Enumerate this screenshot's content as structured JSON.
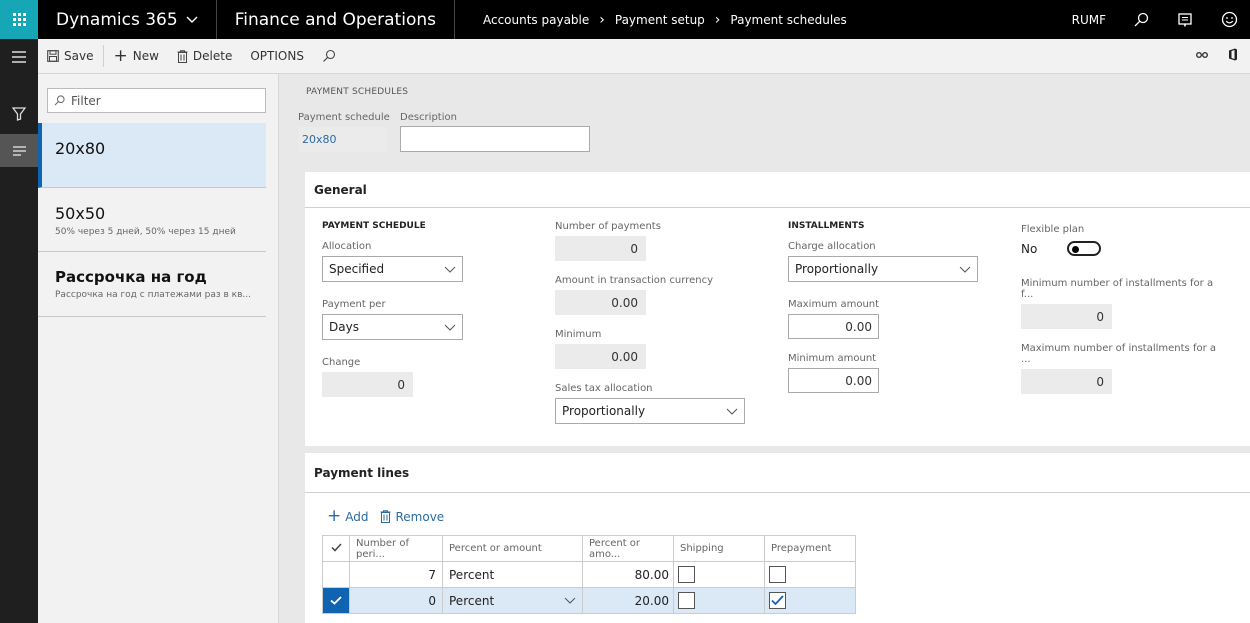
{
  "topbar": {
    "brand": "Dynamics 365",
    "app_name": "Finance and Operations",
    "breadcrumb": [
      "Accounts payable",
      "Payment setup",
      "Payment schedules"
    ],
    "company": "RUMF"
  },
  "actionbar": {
    "save": "Save",
    "new": "New",
    "delete": "Delete",
    "options": "OPTIONS"
  },
  "list": {
    "filter_placeholder": "Filter",
    "items": [
      {
        "title": "20x80",
        "subtitle": ""
      },
      {
        "title": "50x50",
        "subtitle": "50% через 5 дней, 50% через 15 дней"
      },
      {
        "title": "Рассрочка на год",
        "subtitle": "Рассрочка на год с платежами раз в кв..."
      }
    ]
  },
  "header": {
    "section": "PAYMENT SCHEDULES",
    "payment_schedule_label": "Payment schedule",
    "payment_schedule_value": "20x80",
    "description_label": "Description",
    "description_value": ""
  },
  "general": {
    "title": "General",
    "payment_schedule": {
      "group_title": "PAYMENT SCHEDULE",
      "allocation_label": "Allocation",
      "allocation_value": "Specified",
      "payment_per_label": "Payment per",
      "payment_per_value": "Days",
      "change_label": "Change",
      "change_value": "0"
    },
    "amounts": {
      "number_of_payments_label": "Number of payments",
      "number_of_payments_value": "0",
      "amount_currency_label": "Amount in transaction currency",
      "amount_currency_value": "0.00",
      "minimum_label": "Minimum",
      "minimum_value": "0.00",
      "sales_tax_label": "Sales tax allocation",
      "sales_tax_value": "Proportionally"
    },
    "installments": {
      "group_title": "INSTALLMENTS",
      "charge_allocation_label": "Charge allocation",
      "charge_allocation_value": "Proportionally",
      "maximum_amount_label": "Maximum amount",
      "maximum_amount_value": "0.00",
      "minimum_amount_label": "Minimum amount",
      "minimum_amount_value": "0.00"
    },
    "flexible": {
      "flexible_plan_label": "Flexible plan",
      "flexible_plan_value": "No",
      "min_installments_label": "Minimum number of installments for a f...",
      "min_installments_value": "0",
      "max_installments_label": "Maximum number of installments for a ...",
      "max_installments_value": "0"
    }
  },
  "payment_lines": {
    "title": "Payment lines",
    "add": "Add",
    "remove": "Remove",
    "columns": [
      "Number of peri...",
      "Percent or amount",
      "Percent or amo...",
      "Shipping",
      "Prepayment"
    ],
    "rows": [
      {
        "periods": "7",
        "type": "Percent",
        "value": "80.00",
        "shipping": false,
        "prepayment": false,
        "selected": false
      },
      {
        "periods": "0",
        "type": "Percent",
        "value": "20.00",
        "shipping": false,
        "prepayment": true,
        "selected": true
      }
    ]
  }
}
